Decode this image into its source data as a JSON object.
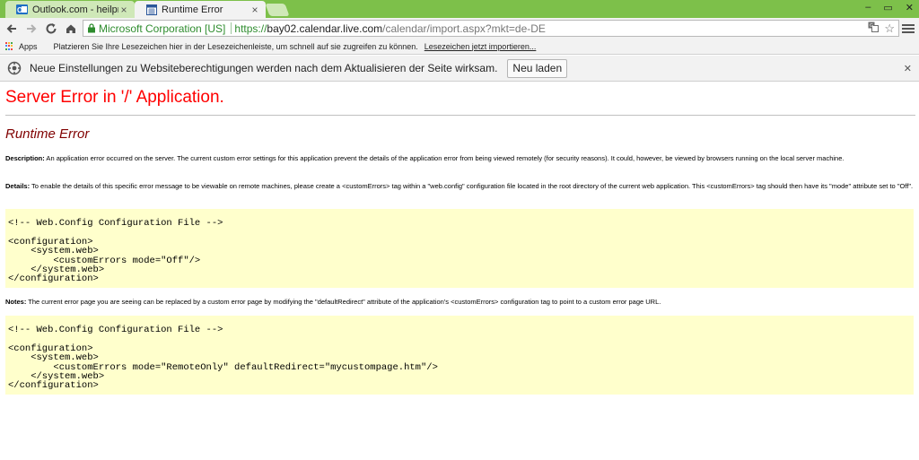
{
  "tabs": [
    {
      "title": "Outlook.com - heilpraxis-",
      "icon": "outlook-icon",
      "active": false
    },
    {
      "title": "Runtime Error",
      "icon": "page-icon",
      "active": true
    }
  ],
  "window_controls": [
    "–",
    "▭",
    "✕"
  ],
  "address": {
    "ev_label": "Microsoft Corporation [US]",
    "scheme": "https://",
    "host": "bay02.calendar.live.com",
    "path": "/calendar/import.aspx?mkt=de-DE"
  },
  "bookmarks": {
    "apps_label": "Apps",
    "hint": "Platzieren Sie Ihre Lesezeichen hier in der Lesezeichenleiste, um schnell auf sie zugreifen zu können.",
    "import_link": "Lesezeichen jetzt importieren..."
  },
  "infobar": {
    "message": "Neue Einstellungen zu Websiteberechtigungen werden nach dem Aktualisieren der Seite wirksam.",
    "button": "Neu laden"
  },
  "page": {
    "title": "Server Error in '/' Application.",
    "subtitle": "Runtime Error",
    "description_label": "Description:",
    "description": " An application error occurred on the server. The current custom error settings for this application prevent the details of the application error from being viewed remotely (for security reasons). It could, however, be viewed by browsers running on the local server machine.",
    "details_label": "Details:",
    "details": " To enable the details of this specific error message to be viewable on remote machines, please create a <customErrors> tag within a \"web.config\" configuration file located in the root directory of the current web application. This <customErrors> tag should then have its \"mode\" attribute set to \"Off\".",
    "code1": "<!-- Web.Config Configuration File -->\n\n<configuration>\n    <system.web>\n        <customErrors mode=\"Off\"/>\n    </system.web>\n</configuration>",
    "notes_label": "Notes:",
    "notes": " The current error page you are seeing can be replaced by a custom error page by modifying the \"defaultRedirect\" attribute of the application's <customErrors> configuration tag to point to a custom error page URL.",
    "code2": "<!-- Web.Config Configuration File -->\n\n<configuration>\n    <system.web>\n        <customErrors mode=\"RemoteOnly\" defaultRedirect=\"mycustompage.htm\"/>\n    </system.web>\n</configuration>"
  },
  "colors": {
    "titlebar": "#7dc04a",
    "error_title": "#ff0000",
    "error_subtitle": "#800000",
    "code_bg": "#ffffcc",
    "ev_green": "#2e8c2e"
  }
}
